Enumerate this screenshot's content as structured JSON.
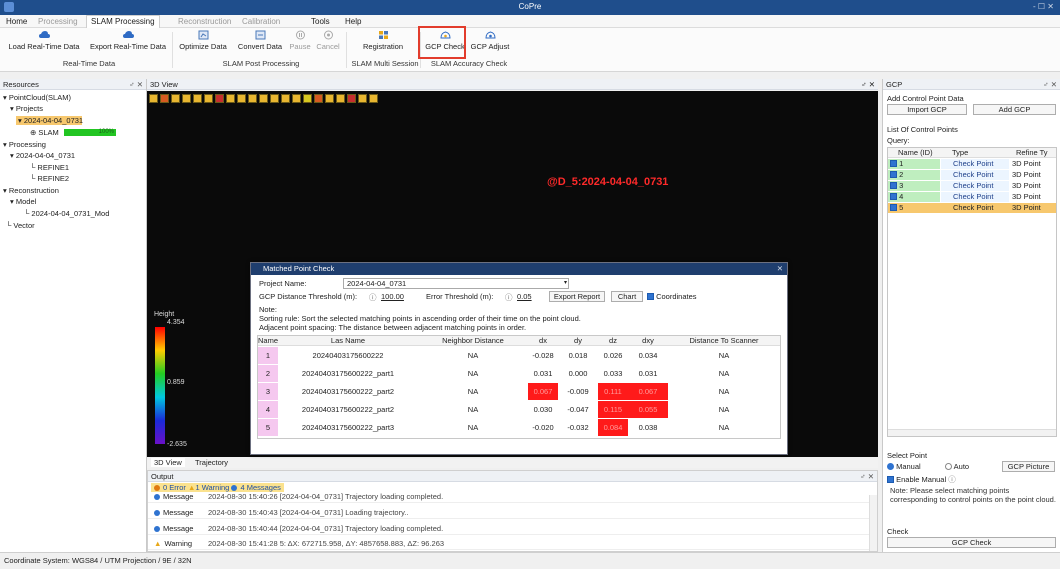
{
  "app": {
    "title": "CoPre",
    "window_controls": "- ☐ ✕"
  },
  "menu": {
    "items": [
      "Home",
      "Processing",
      "SLAM Processing",
      "Reconstruction",
      "Calibration",
      "Tools",
      "Help"
    ]
  },
  "ribbon": {
    "buttons": [
      "Load Real-Time Data",
      "Export Real-Time Data",
      "Optimize Data",
      "Convert Data",
      "Pause",
      "Cancel",
      "Registration",
      "GCP Check",
      "GCP Adjust"
    ],
    "groups": [
      "Real-Time Data",
      "SLAM Post Processing",
      "SLAM Multi Session",
      "SLAM Accuracy Check"
    ]
  },
  "resources": {
    "title": "Resources",
    "pin": "♂ ✕",
    "tree": [
      "PointCloud(SLAM)",
      "Projects",
      "2024-04-04_0731",
      "SLAM",
      "100%",
      "Processing",
      "2024-04-04_0731",
      "REFINE1",
      "REFINE2",
      "Reconstruction",
      "Model",
      "2024-04-04_0731_Mod",
      "Vector"
    ]
  },
  "view3d": {
    "title": "3D View",
    "pin": "♂ ✕",
    "label": "@D_5:2024-04-04_0731",
    "legend_title": "Height",
    "legend_values": [
      "4.354",
      "0.859",
      "-2.635"
    ],
    "tabs": [
      "3D View",
      "Trajectory"
    ]
  },
  "dialog": {
    "title": "Matched Point Check",
    "project_label": "Project Name:",
    "project_value": "2024-04-04_0731",
    "gcp_threshold_label": "GCP Distance Threshold (m):",
    "gcp_threshold_value": "100.00",
    "error_threshold_label": "Error Threshold (m):",
    "error_threshold_value": "0.05",
    "export_button": "Export Report",
    "chart_button": "Chart",
    "coordinates_label": "Coordinates",
    "note_title": "Note:",
    "note1": "Sorting rule: Sort the selected matching points in ascending order of their time on the point cloud.",
    "note2": "Adjacent point spacing: The distance between adjacent matching points in order.",
    "headers": [
      "Name",
      "Las Name",
      "Neighbor Distance",
      "dx",
      "dy",
      "dz",
      "dxy",
      "Distance To Scanner"
    ],
    "rows": [
      [
        "1",
        "20240403175600222",
        "NA",
        "-0.028",
        "0.018",
        "0.026",
        "0.034",
        "NA"
      ],
      [
        "2",
        "20240403175600222_part1",
        "NA",
        "0.031",
        "0.000",
        "0.033",
        "0.031",
        "NA"
      ],
      [
        "3",
        "20240403175600222_part2",
        "NA",
        "0.067",
        "-0.009",
        "0.111",
        "0.067",
        "NA"
      ],
      [
        "4",
        "20240403175600222_part2",
        "NA",
        "0.030",
        "-0.047",
        "0.115",
        "0.055",
        "NA"
      ],
      [
        "5",
        "20240403175600222_part3",
        "NA",
        "-0.020",
        "-0.032",
        "0.084",
        "0.038",
        "NA"
      ]
    ]
  },
  "output": {
    "title": "Output",
    "pin": "♂ ✕",
    "filters": [
      "0 Error",
      "1 Warning",
      "4 Messages"
    ],
    "rows": [
      [
        "Message",
        "2024-08-30 15:40:26 [2024-04-04_0731] Trajectory loading completed."
      ],
      [
        "Message",
        "2024-08-30 15:40:43 [2024-04-04_0731] Loading trajectory.."
      ],
      [
        "Message",
        "2024-08-30 15:40:44 [2024-04-04_0731] Trajectory loading completed."
      ],
      [
        "Warning",
        "2024-08-30 15:41:28 5: ΔX: 672715.958, ΔY: 4857658.883, ΔZ: 96.263"
      ]
    ]
  },
  "gcp": {
    "title": "GCP",
    "pin": "♂ ✕",
    "add_section": "Add Control Point Data",
    "import_button": "Import GCP",
    "add_button": "Add GCP",
    "list_section": "List Of Control Points",
    "query_label": "Query:",
    "headers": [
      "Name (ID)",
      "Type",
      "Refine Ty"
    ],
    "rows": [
      [
        "1",
        "Check Point",
        "3D Point"
      ],
      [
        "2",
        "Check Point",
        "3D Point"
      ],
      [
        "3",
        "Check Point",
        "3D Point"
      ],
      [
        "4",
        "Check Point",
        "3D Point"
      ],
      [
        "5",
        "Check Point",
        "3D Point"
      ]
    ],
    "select_section": "Select Point",
    "manual_label": "Manual",
    "auto_label": "Auto",
    "picture_button": "GCP Picture",
    "enable_manual": "Enable Manual",
    "note": "Note: Please select matching points corresponding to control points on the point cloud.",
    "check_section": "Check",
    "check_button": "GCP Check"
  },
  "status": {
    "text": "Coordinate System: WGS84 / UTM Projection / 9E / 32N"
  },
  "colors": {
    "accent": "#1f4e8c",
    "highlight_red": "#ff1a1a",
    "selected_row": "#f7c86e",
    "pink_cell": "#f5c8ef"
  }
}
